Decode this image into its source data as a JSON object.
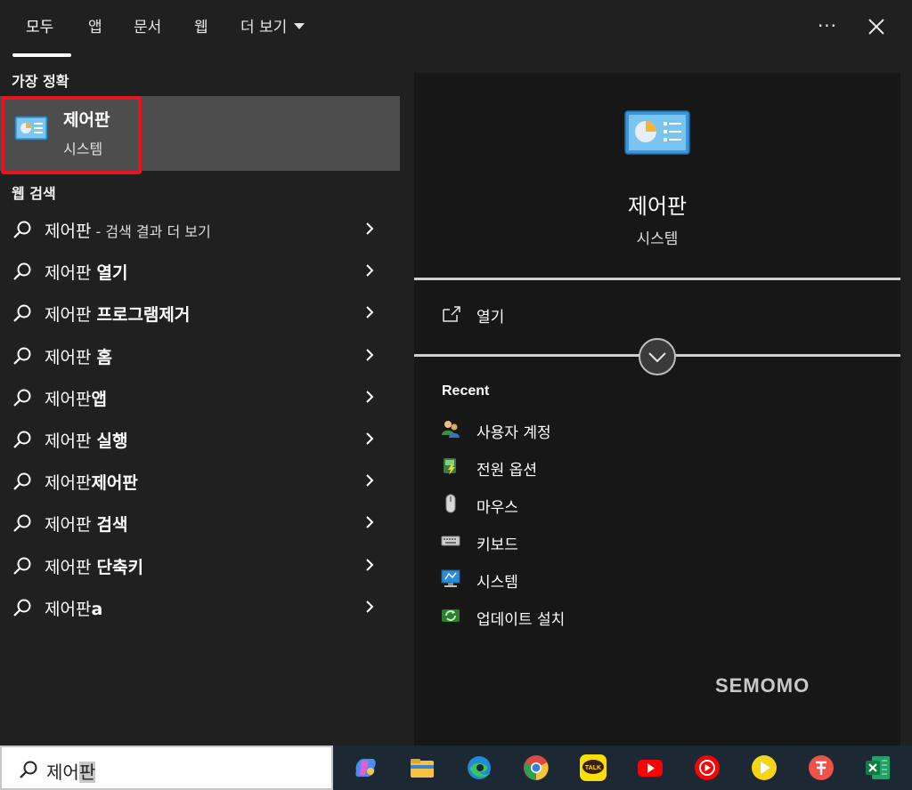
{
  "tabs": [
    {
      "label": "모두"
    },
    {
      "label": "앱"
    },
    {
      "label": "문서"
    },
    {
      "label": "웹"
    },
    {
      "label": "더 보기"
    }
  ],
  "more_label": "···",
  "best_match": {
    "section_label": "가장 정확",
    "title": "제어판",
    "subtitle": "시스템"
  },
  "web_search": {
    "section_label": "웹 검색",
    "items": [
      {
        "prefix": "제어판",
        "suffix_small": " - 검색 결과 더 보기",
        "suffix_bold": ""
      },
      {
        "prefix": "제어판 ",
        "suffix_small": "",
        "suffix_bold": "열기"
      },
      {
        "prefix": "제어판 ",
        "suffix_small": "",
        "suffix_bold": "프로그램제거"
      },
      {
        "prefix": "제어판 ",
        "suffix_small": "",
        "suffix_bold": "홈"
      },
      {
        "prefix": "제어판",
        "suffix_small": "",
        "suffix_bold": "앱"
      },
      {
        "prefix": "제어판 ",
        "suffix_small": "",
        "suffix_bold": "실행"
      },
      {
        "prefix": "제어판",
        "suffix_small": "",
        "suffix_bold": "제어판"
      },
      {
        "prefix": "제어판 ",
        "suffix_small": "",
        "suffix_bold": "검색"
      },
      {
        "prefix": "제어판 ",
        "suffix_small": "",
        "suffix_bold": "단축키"
      },
      {
        "prefix": "제어판",
        "suffix_small": "",
        "suffix_bold": "a"
      }
    ]
  },
  "detail": {
    "title": "제어판",
    "subtitle": "시스템",
    "open_label": "열기",
    "recent_label": "Recent",
    "recent": [
      {
        "label": "사용자 계정",
        "icon": "user-accounts-icon"
      },
      {
        "label": "전원 옵션",
        "icon": "power-options-icon"
      },
      {
        "label": "마우스",
        "icon": "mouse-icon"
      },
      {
        "label": "키보드",
        "icon": "keyboard-icon"
      },
      {
        "label": "시스템",
        "icon": "system-icon"
      },
      {
        "label": "업데이트 설치",
        "icon": "windows-update-icon"
      }
    ]
  },
  "watermark": "SEMOMO",
  "search": {
    "typed": "제어",
    "selected": "판"
  },
  "taskbar_icons": [
    "copilot-icon",
    "file-explorer-icon",
    "edge-icon",
    "chrome-icon",
    "kakaotalk-icon",
    "youtube-icon",
    "youtube-music-icon",
    "media-player-icon",
    "app-icon",
    "excel-icon"
  ],
  "kakao_label": "TALK",
  "colors": {
    "highlight": "#e8141c",
    "selected_row": "#4d4d4d",
    "panel": "#171717",
    "background": "#202020"
  }
}
